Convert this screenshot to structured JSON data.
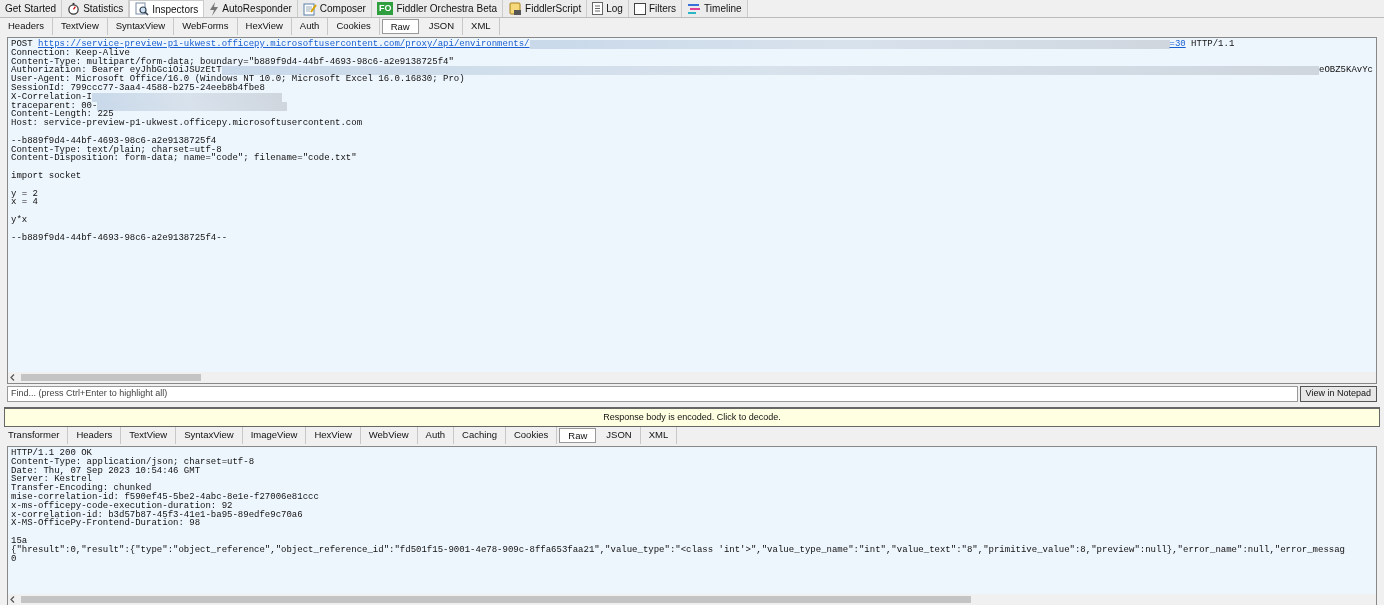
{
  "main_tabs": [
    {
      "label": "Get Started",
      "selected": false
    },
    {
      "label": "Statistics",
      "kind": "stopwatch",
      "selected": false
    },
    {
      "label": "Inspectors",
      "kind": "inspect",
      "selected": true
    },
    {
      "label": "AutoResponder",
      "kind": "bolt",
      "selected": false
    },
    {
      "label": "Composer",
      "kind": "notepad",
      "selected": false
    },
    {
      "label": "Fiddler Orchestra Beta",
      "kind": "badge",
      "badge": "FO",
      "selected": false
    },
    {
      "label": "FiddlerScript",
      "kind": "script",
      "selected": false
    },
    {
      "label": "Log",
      "kind": "doc",
      "selected": false
    },
    {
      "label": "Filters",
      "kind": "checkbox",
      "selected": false
    },
    {
      "label": "Timeline",
      "kind": "timeline",
      "selected": false
    }
  ],
  "request": {
    "tabs": [
      {
        "label": "Headers",
        "selected": false
      },
      {
        "label": "TextView",
        "selected": false
      },
      {
        "label": "SyntaxView",
        "selected": false
      },
      {
        "label": "WebForms",
        "selected": false
      },
      {
        "label": "HexView",
        "selected": false
      },
      {
        "label": "Auth",
        "selected": false
      },
      {
        "label": "Cookies",
        "selected": false
      },
      {
        "label": "Raw",
        "selected": true
      },
      {
        "label": "JSON",
        "selected": false
      },
      {
        "label": "XML",
        "selected": false
      }
    ],
    "blocks": [
      [
        [
          {
            "kind": "text",
            "text": "POST "
          },
          {
            "kind": "link",
            "text": "https://service-preview-p1-ukwest.officepy.microsoftusercontent.com/proxy/api/environments/"
          },
          {
            "kind": "redacted"
          },
          {
            "kind": "link",
            "text": "=30"
          },
          {
            "kind": "text",
            "text": " HTTP/1.1"
          }
        ],
        [
          {
            "kind": "text",
            "text": "Connection: Keep-Alive"
          }
        ],
        [
          {
            "kind": "text",
            "text": "Content-Type: multipart/form-data; boundary=\"b889f9d4-44bf-4693-98c6-a2e9138725f4\""
          }
        ],
        [
          {
            "kind": "text",
            "text": "Authorization: Bearer eyJhbGciOiJSUzEtT"
          },
          {
            "kind": "redacted"
          },
          {
            "kind": "text",
            "text": "eOBZ5KAvYc"
          }
        ],
        [
          {
            "kind": "text",
            "text": "User-Agent: Microsoft Office/16.0 (Windows NT 10.0; Microsoft Excel 16.0.16830; Pro)"
          }
        ],
        [
          {
            "kind": "text",
            "text": "SessionId: 799ccc77-3aa4-4588-b275-24eeb8b4fbe8"
          }
        ],
        [
          {
            "kind": "text",
            "text": "X-Correlation-I"
          },
          {
            "kind": "redacted"
          }
        ],
        [
          {
            "kind": "text",
            "text": "traceparent: 00-"
          },
          {
            "kind": "redacted"
          }
        ],
        [
          {
            "kind": "text",
            "text": "Content-Length: 225"
          }
        ],
        [
          {
            "kind": "text",
            "text": "Host: service-preview-p1-ukwest.officepy.microsoftusercontent.com"
          }
        ]
      ],
      [
        [
          {
            "kind": "text",
            "text": "--b889f9d4-44bf-4693-98c6-a2e9138725f4"
          }
        ],
        [
          {
            "kind": "text",
            "text": "Content-Type: text/plain; charset=utf-8"
          }
        ],
        [
          {
            "kind": "text",
            "text": "Content-Disposition: form-data; name=\"code\"; filename=\"code.txt\""
          }
        ]
      ],
      [
        [
          {
            "kind": "text",
            "text": "import socket"
          }
        ]
      ],
      [
        [
          {
            "kind": "text",
            "text": "y = 2"
          }
        ],
        [
          {
            "kind": "text",
            "text": "x = 4"
          }
        ]
      ],
      [
        [
          {
            "kind": "text",
            "text": "y*x"
          }
        ]
      ],
      [
        [
          {
            "kind": "text",
            "text": "--b889f9d4-44bf-4693-98c6-a2e9138725f4--"
          }
        ]
      ]
    ],
    "find": {
      "placeholder": "Find... (press Ctrl+Enter to highlight all)"
    },
    "notepad_button": "View in Notepad"
  },
  "notice": "Response body is encoded. Click to decode.",
  "response": {
    "tabs": [
      {
        "label": "Transformer",
        "selected": false
      },
      {
        "label": "Headers",
        "selected": false
      },
      {
        "label": "TextView",
        "selected": false
      },
      {
        "label": "SyntaxView",
        "selected": false
      },
      {
        "label": "ImageView",
        "selected": false
      },
      {
        "label": "HexView",
        "selected": false
      },
      {
        "label": "WebView",
        "selected": false
      },
      {
        "label": "Auth",
        "selected": false
      },
      {
        "label": "Caching",
        "selected": false
      },
      {
        "label": "Cookies",
        "selected": false
      },
      {
        "label": "Raw",
        "selected": true
      },
      {
        "label": "JSON",
        "selected": false
      },
      {
        "label": "XML",
        "selected": false
      }
    ],
    "blocks": [
      [
        "HTTP/1.1 200 OK",
        "Content-Type: application/json; charset=utf-8",
        "Date: Thu, 07 Sep 2023 10:54:46 GMT",
        "Server: Kestrel",
        "Transfer-Encoding: chunked",
        "mise-correlation-id: f590ef45-5be2-4abc-8e1e-f27006e81ccc",
        "x-ms-officepy-code-execution-duration: 92",
        "x-correlation-id: b3d57b87-45f3-41e1-ba95-89edfe9c70a6",
        "X-MS-OfficePy-Frontend-Duration: 98"
      ],
      [
        "15a",
        "{\"hresult\":0,\"result\":{\"type\":\"object_reference\",\"object_reference_id\":\"fd501f15-9001-4e78-909c-8ffa653faa21\",\"value_type\":\"<class 'int'>\",\"value_type_name\":\"int\",\"value_text\":\"8\",\"primitive_value\":8,\"preview\":null},\"error_name\":null,\"error_messag",
        "0"
      ]
    ]
  }
}
